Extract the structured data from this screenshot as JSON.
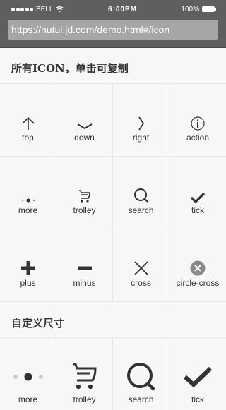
{
  "status": {
    "carrier": "BELL",
    "time": "6:00PM",
    "battery": "100%"
  },
  "url": "https://nutui.jd.com/demo.html#/icon",
  "sections": {
    "all_title": "所有ICON，单击可复制",
    "custom_title": "自定义尺寸"
  },
  "icons": [
    {
      "label": "top",
      "icon": "top-icon"
    },
    {
      "label": "down",
      "icon": "down-icon"
    },
    {
      "label": "right",
      "icon": "right-icon"
    },
    {
      "label": "action",
      "icon": "action-icon"
    },
    {
      "label": "more",
      "icon": "more-icon"
    },
    {
      "label": "trolley",
      "icon": "trolley-icon"
    },
    {
      "label": "search",
      "icon": "search-icon"
    },
    {
      "label": "tick",
      "icon": "tick-icon"
    },
    {
      "label": "plus",
      "icon": "plus-icon"
    },
    {
      "label": "minus",
      "icon": "minus-icon"
    },
    {
      "label": "cross",
      "icon": "cross-icon"
    },
    {
      "label": "circle-cross",
      "icon": "circle-cross-icon"
    }
  ],
  "custom_icons": [
    {
      "label": "more",
      "icon": "more-icon"
    },
    {
      "label": "trolley",
      "icon": "trolley-icon"
    },
    {
      "label": "search",
      "icon": "search-icon"
    },
    {
      "label": "tick",
      "icon": "tick-icon"
    }
  ],
  "colors": {
    "icon": "#333333",
    "bar": "#5f5f5f",
    "circle_cross_bg": "#8a8a8a"
  }
}
